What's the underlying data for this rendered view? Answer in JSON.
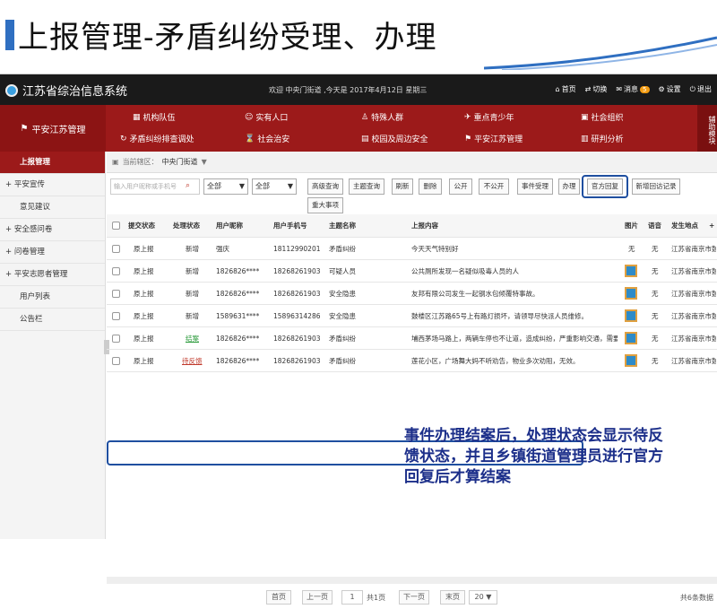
{
  "slide": {
    "title": "上报管理-矛盾纠纷受理、办理"
  },
  "topbar": {
    "app_title": "江苏省综治信息系统",
    "welcome": "欢迎 中央门街道 ,今天是 2017年4月12日 星期三",
    "tools": {
      "home": "首页",
      "switch": "切换",
      "message": "消息",
      "message_badge": "5",
      "settings": "设置",
      "logout": "退出"
    }
  },
  "nav": {
    "brand": "平安江苏管理",
    "row1": [
      "机构队伍",
      "实有人口",
      "特殊人群",
      "重点青少年",
      "社会组织"
    ],
    "row2": [
      "矛盾纠纷排查调处",
      "社会治安",
      "校园及周边安全",
      "平安江苏管理",
      "研判分析"
    ],
    "side": "辅助模块"
  },
  "sidebar": {
    "items": [
      "上报管理",
      "+ 平安宣传",
      "意见建议",
      "+ 安全感问卷",
      "+ 问卷管理",
      "+ 平安志愿者管理",
      "用户列表",
      "公告栏"
    ]
  },
  "crumb": {
    "label": "当前辖区：",
    "value": "中央门街道"
  },
  "toolbar": {
    "search_placeholder": "输入用户昵称或手机号",
    "select1": "全部",
    "select2": "全部",
    "buttons": [
      "高级查询",
      "主题查询",
      "刷新",
      "删除",
      "公开",
      "不公开",
      "事件受理",
      "办理",
      "官方回复",
      "新增回访记录"
    ],
    "button_extra": "重大事项"
  },
  "table": {
    "headers": [
      "提交状态",
      "处理状态",
      "用户昵称",
      "用户手机号",
      "主题名称",
      "上报内容",
      "图片",
      "语音",
      "发生地点"
    ],
    "rows": [
      [
        "原上报",
        "新增",
        "强庆",
        "18112990201",
        "矛盾纠纷",
        "今天天气特别好",
        "无",
        "无",
        "江苏省南京市鼓"
      ],
      [
        "原上报",
        "新增",
        "1826826****",
        "18268261903",
        "可疑人员",
        "公共厕所发现一名疑似吸毒人员的人",
        "img",
        "无",
        "江苏省南京市鼓"
      ],
      [
        "原上报",
        "新增",
        "1826826****",
        "18268261903",
        "安全隐患",
        "友邦有限公司发生一起钢水包倾覆特事故。",
        "img",
        "无",
        "江苏省南京市鼓"
      ],
      [
        "原上报",
        "新增",
        "1589631****",
        "15896314286",
        "安全隐患",
        "鼓楼区江苏路65号上有路灯损坏，请领导尽快派人员维修。",
        "img",
        "无",
        "江苏省南京市鼓"
      ],
      [
        "原上报",
        "结案",
        "1826826****",
        "18268261903",
        "矛盾纠纷",
        "埔西茅场马路上，两辆车停也不让道，造成纠纷，严重影响交通，需要及时",
        "img",
        "无",
        "江苏省南京市鼓"
      ],
      [
        "原上报",
        "待反馈",
        "1826826****",
        "18268261903",
        "矛盾纠纷",
        "莲花小区，广场舞大妈不听劝告，物业多次劝阻，无效。",
        "img",
        "无",
        "江苏省南京市鼓"
      ]
    ]
  },
  "note": "事件办理结案后，处理状态会显示待反馈状态，并且乡镇街道管理员进行官方回复后才算结案",
  "pager": {
    "first": "首页",
    "prev": "上一页",
    "page": "1",
    "total_pages": "共1页",
    "next": "下一页",
    "last": "末页",
    "size": "20",
    "total": "共6条数据"
  },
  "colors": {
    "nav_red": "#9c1a1a",
    "topbar": "#1a1a1a",
    "highlight": "#1f4fa0",
    "note_text": "#1c2f8a"
  }
}
